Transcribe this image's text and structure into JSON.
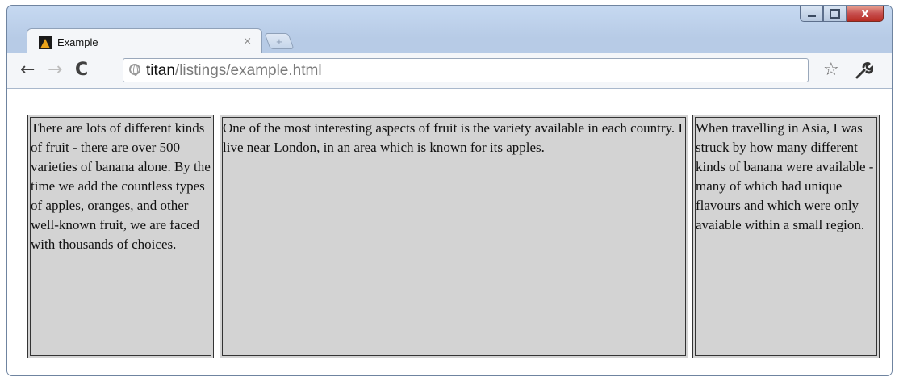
{
  "tab": {
    "title": "Example",
    "close_glyph": "×",
    "new_tab_glyph": "+"
  },
  "window_controls": {
    "minimize_glyph": "",
    "maximize_glyph": "",
    "close_glyph": "x"
  },
  "toolbar": {
    "back_glyph": "←",
    "forward_glyph": "→",
    "reload_glyph": "C",
    "star_glyph": "☆"
  },
  "address_bar": {
    "host": "titan",
    "path": "/listings/example.html"
  },
  "columns": [
    {
      "text": "There are lots of different kinds of fruit - there are over 500 varieties of banana alone. By the time we add the countless types of apples, oranges, and other well-known fruit, we are faced with thousands of choices."
    },
    {
      "text": "One of the most interesting aspects of fruit is the variety available in each country. I live near London, in an area which is known for its apples."
    },
    {
      "text": "When travelling in Asia, I was struck by how many different kinds of banana were available - many of which had unique flavours and which were only avaiable within a small region."
    }
  ],
  "colors": {
    "column_background": "#d3d3d3",
    "column_border": "#333333",
    "window_frame": "#b7cbe6",
    "close_button": "#c75050"
  }
}
